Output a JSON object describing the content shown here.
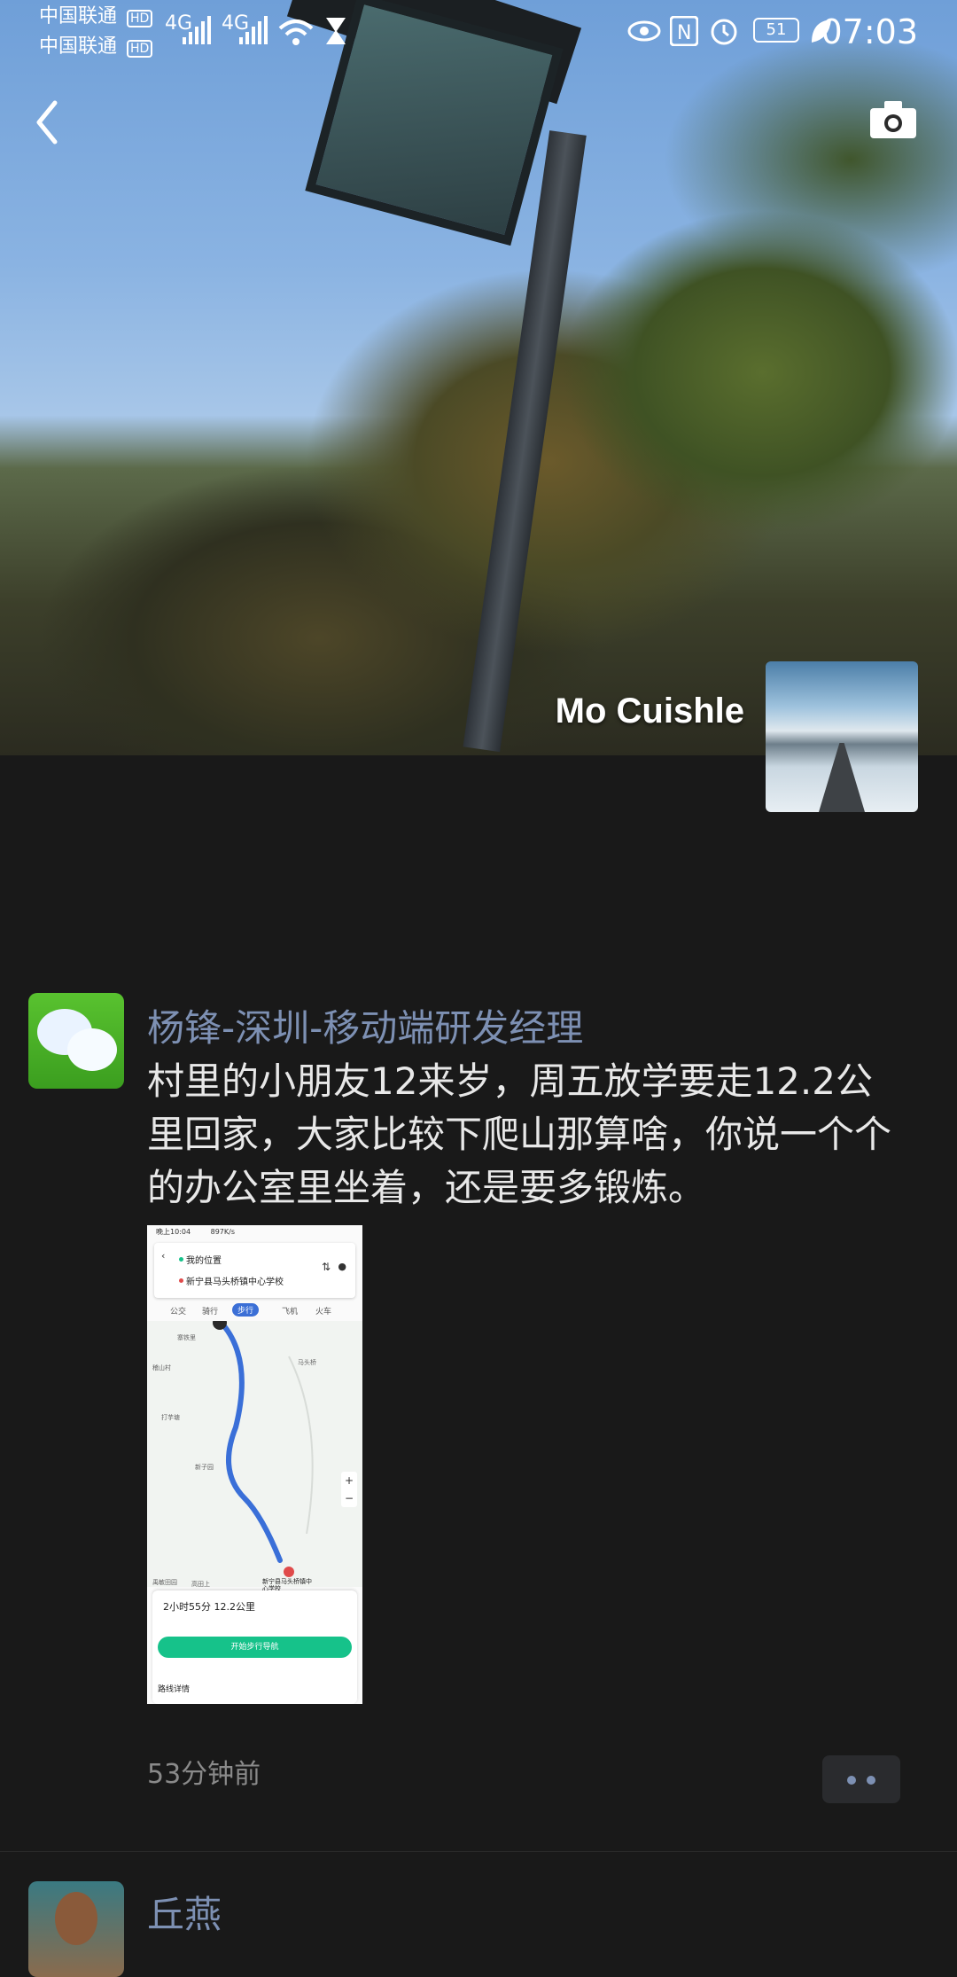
{
  "status_bar": {
    "carrier1": "中国联通",
    "carrier2": "中国联通",
    "hd_badge": "HD",
    "net1": "4G",
    "net2": "4G",
    "battery": "51",
    "time": "07:03"
  },
  "header": {
    "back_icon": "chevron-left-icon",
    "camera_icon": "camera-icon",
    "profile_name": "Mo Cuishle"
  },
  "post": {
    "author": "杨锋-深圳-移动端研发经理",
    "text": "村里的小朋友12来岁，周五放学要走12.2公里回家，大家比较下爬山那算啥，你说一个个的办公室里坐着，还是要多锻炼。",
    "image": {
      "status_time": "晚上10:04",
      "speed": "897K/s",
      "from": "我的位置",
      "to": "新宁县马头桥镇中心学校",
      "tabs": [
        "公交",
        "骑行",
        "步行",
        "飞机",
        "火车"
      ],
      "selected_tab": "步行",
      "duration_distance": "2小时55分  12.2公里",
      "start_button": "开始步行导航",
      "route_details": "路线详情",
      "destination_label": "新宁县马头桥镇中心学校",
      "map_labels": [
        "寨铁里",
        "稽山村",
        "打芋塘",
        "新子园",
        "马头桥",
        "高田上",
        "禹敏田园"
      ]
    },
    "time_ago": "53分钟前",
    "more_icon": "more-dots-icon"
  },
  "next_post": {
    "author": "丘燕"
  },
  "colors": {
    "background": "#191919",
    "author_name": "#7d90b3",
    "body_text": "#e8e8e8",
    "timestamp": "#8a8a8a",
    "nav_green": "#16c28a"
  }
}
